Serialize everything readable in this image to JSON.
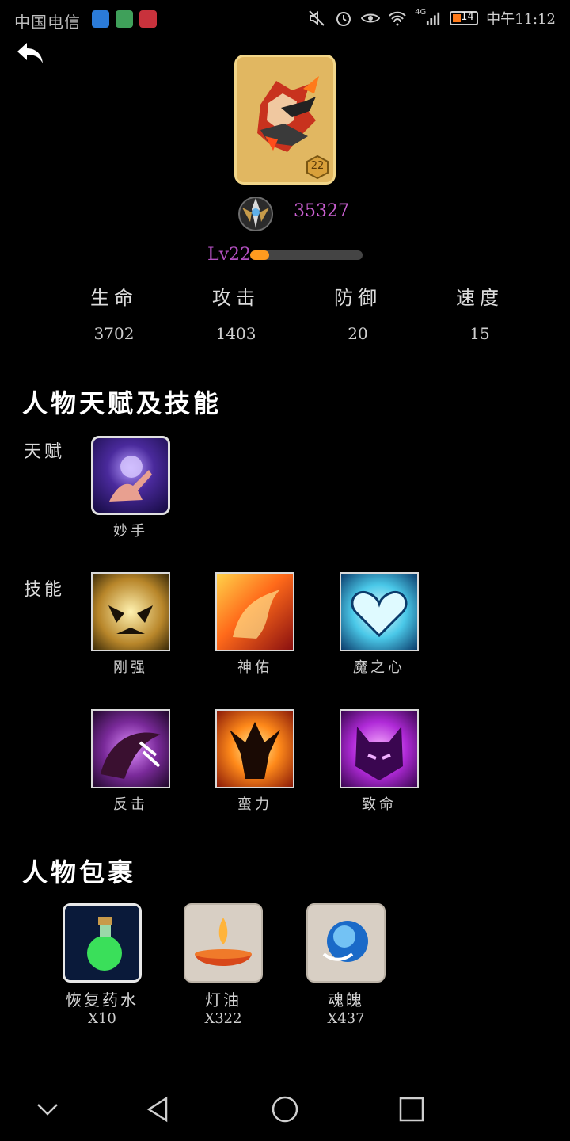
{
  "status_bar": {
    "carrier": "中国电信",
    "network": "4G",
    "battery": "14",
    "time": "中午11:12"
  },
  "hero": {
    "level_badge": "22",
    "power": "35327",
    "level_text": "Lv22",
    "xp_progress": 0.17
  },
  "stats": [
    {
      "label": "生命",
      "value": "3702"
    },
    {
      "label": "攻击",
      "value": "1403"
    },
    {
      "label": "防御",
      "value": "20"
    },
    {
      "label": "速度",
      "value": "15"
    }
  ],
  "talents_section": {
    "title": "人物天赋及技能",
    "talent_label": "天赋",
    "skill_label": "技能",
    "talents": [
      {
        "name": "妙手"
      }
    ],
    "skills": [
      {
        "name": "刚强"
      },
      {
        "name": "神佑"
      },
      {
        "name": "魔之心"
      },
      {
        "name": "反击"
      },
      {
        "name": "蛮力"
      },
      {
        "name": "致命"
      }
    ]
  },
  "inventory": {
    "title": "人物包裹",
    "items": [
      {
        "name": "恢复药水",
        "qty": "X10"
      },
      {
        "name": "灯油",
        "qty": "X322"
      },
      {
        "name": "魂魄",
        "qty": "X437"
      }
    ]
  },
  "colors": {
    "accent_purple": "#c95fd0",
    "xp_orange": "#ff9b1f",
    "portrait_gold": "#e1b761"
  }
}
